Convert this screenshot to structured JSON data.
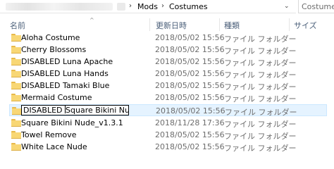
{
  "address": {
    "crumbs": [
      "Mods",
      "Costumes"
    ],
    "separator": "›",
    "dropdown": "⌄"
  },
  "search": {
    "value": "Costume"
  },
  "columns": {
    "name": "名前",
    "date": "更新日時",
    "type": "種類",
    "size": "サイズ",
    "sort_indicator": "^"
  },
  "rows": [
    {
      "name": "Aloha Costume",
      "date": "2018/05/02 15:56",
      "type": "ファイル フォルダー"
    },
    {
      "name": "Cherry Blossoms",
      "date": "2018/05/02 15:56",
      "type": "ファイル フォルダー"
    },
    {
      "name": "DISABLED Luna Apache",
      "date": "2018/05/02 15:56",
      "type": "ファイル フォルダー"
    },
    {
      "name": "DISABLED Luna Hands",
      "date": "2018/05/02 15:56",
      "type": "ファイル フォルダー"
    },
    {
      "name": "DISABLED Tamaki Blue",
      "date": "2018/05/02 15:56",
      "type": "ファイル フォルダー"
    },
    {
      "name": "Mermaid Costume",
      "date": "2018/05/02 15:56",
      "type": "ファイル フォルダー"
    },
    {
      "name_selected": "DISABLED",
      "name_rest": "Square Bikini Nude",
      "date": "2018/05/02 15:56",
      "type": "ファイル フォルダー",
      "selected": true
    },
    {
      "name": "Square Bikini Nude_v1.3.1",
      "date": "2018/11/28 17:36",
      "type": "ファイル フォルダー"
    },
    {
      "name": "Towel Remove",
      "date": "2018/05/02 15:56",
      "type": "ファイル フォルダー"
    },
    {
      "name": "White Lace Nude",
      "date": "2018/05/02 15:56",
      "type": "ファイル フォルダー"
    }
  ],
  "colors": {
    "selection_bg": "#e5f3ff",
    "selection_border": "#cce8ff",
    "folder": "#f8d775",
    "header_text": "#4c607a"
  },
  "icons": {
    "folder": "folder-icon"
  }
}
